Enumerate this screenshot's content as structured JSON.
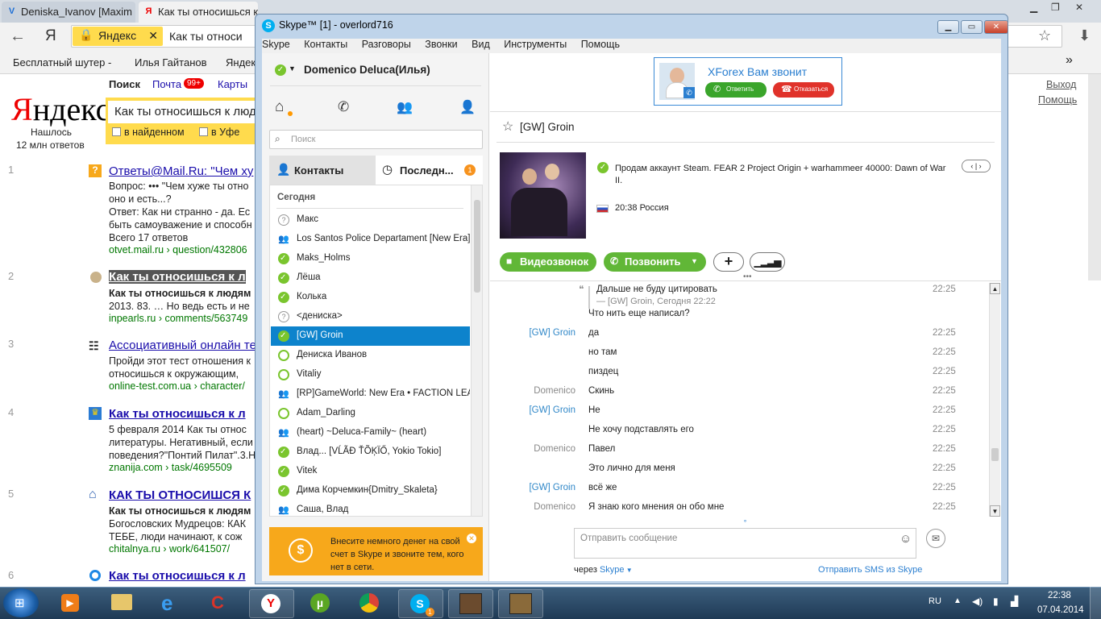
{
  "browser": {
    "tabs": [
      {
        "label": "Deniska_Ivanov [Maxim",
        "fav": "V"
      },
      {
        "label": "Как ты относишься к",
        "fav": "Я"
      }
    ],
    "back_icon": "arrow-left-icon",
    "ya_logo": "Я",
    "address_tag": "Яндекс",
    "address_text": "Как ты относи",
    "bookmarks": [
      "Бесплатный шутер -",
      "Илья Гайтанов",
      "Яндек"
    ],
    "more": "»"
  },
  "yandex": {
    "nav": [
      "Поиск",
      "Почта",
      "Карты"
    ],
    "mail_badge": "99+",
    "logo": "Яндекс",
    "found": "Нашлось",
    "found_count": "12 млн ответов",
    "query": "Как ты относишься к люд",
    "filter_in_found": "в найденном",
    "filter_city": "в Уфе",
    "exit": "Выход",
    "help": "Помощь",
    "results": [
      {
        "num": "1",
        "title": "Ответы@Mail.Ru: \"Чем ху",
        "lines": [
          "Вопрос: ••• \"Чем хуже ты отно",
          "оно и есть...?",
          "Ответ: Как ни странно - да. Ес",
          "быть самоуважение и способн",
          "Всего 17 ответов"
        ],
        "url": "otvet.mail.ru › question/432806"
      },
      {
        "num": "2",
        "title": "Как ты относишься к л",
        "lines": [
          "Как ты относишься к людям",
          "2013. 83. … Но ведь есть и не"
        ],
        "url": "inpearls.ru › comments/563749"
      },
      {
        "num": "3",
        "title": "Ассоциативный онлайн те",
        "lines": [
          "Пройди этот тест отношения к",
          "относишься к окружающим,"
        ],
        "url": "online-test.com.ua › character/"
      },
      {
        "num": "4",
        "title": "Как ты относишься к л",
        "lines": [
          "5 февраля 2014 Как ты относ",
          "литературы. Негативный, если",
          "поведения?\"Понтий Пилат\".3.Н"
        ],
        "url": "znanija.com › task/4695509"
      },
      {
        "num": "5",
        "title": "КАК ТЫ ОТНОСИШСЯ К",
        "lines": [
          "Как ты относишься к людям",
          "Богословских Мудрецов: КАК",
          "ТЕБЕ, люди начинают, к сож"
        ],
        "url": "chitalnya.ru › work/641507/"
      },
      {
        "num": "6",
        "title": "Как ты относишься к л",
        "lines": [],
        "url": ""
      }
    ]
  },
  "skype": {
    "title": "Skype™ [1] - overlord716",
    "menu": [
      "Skype",
      "Контакты",
      "Разговоры",
      "Звонки",
      "Вид",
      "Инструменты",
      "Помощь"
    ],
    "user_name": "Domenico Deluca(Илья)",
    "search_placeholder": "Поиск",
    "tab_contacts": "Контакты",
    "tab_recent": "Последн...",
    "recent_badge": "1",
    "section_today": "Сегодня",
    "contacts": [
      {
        "name": "Макс",
        "status": "unk"
      },
      {
        "name": "Los Santos Police Departament [New Era]",
        "status": "grp"
      },
      {
        "name": "Maks_Holms",
        "status": "on"
      },
      {
        "name": "Лёша",
        "status": "on"
      },
      {
        "name": "Колька",
        "status": "on"
      },
      {
        "name": "<дениска>",
        "status": "unk"
      },
      {
        "name": "[GW] Groin",
        "status": "on",
        "selected": true
      },
      {
        "name": "Дениска Иванов",
        "status": "off"
      },
      {
        "name": "Vitaliy",
        "status": "off"
      },
      {
        "name": "[RP]GameWorld: New Era • FACTION LEA...",
        "status": "grp"
      },
      {
        "name": "Adam_Darling",
        "status": "off"
      },
      {
        "name": "(heart) ~Deluca-Family~ (heart)",
        "status": "grp"
      },
      {
        "name": "Влад... [VĹÃĐ ŤÕĶÏŐ, Yokio Tokio]",
        "status": "on"
      },
      {
        "name": "Vitek",
        "status": "on"
      },
      {
        "name": "Дима Корчемкин{Dmitry_Skaleta}",
        "status": "on"
      },
      {
        "name": "Саша, Влад",
        "status": "grp"
      }
    ],
    "promo_text": "Внесите немного денег на свой счет в Skype и звоните тем, кого нет в сети.",
    "call": {
      "caller": "XForex Вам звонит",
      "answer": "Ответить",
      "decline": "Отказаться"
    },
    "chat_name": "[GW] Groin",
    "mood": "Продам аккаунт Steam. FEAR 2 Project Origin + warhammeer 40000: Dawn of War II.",
    "local_time": "20:38 Россия",
    "video_call": "Видеозвонок",
    "call_btn": "Позвонить",
    "plus": "+",
    "quote_text": "Дальше не буду цитировать",
    "quote_meta": "— [GW] Groin, Сегодня 22:22",
    "quote_time": "22:25",
    "messages": [
      {
        "who": "",
        "text": "Что нить еще написал?",
        "time": ""
      },
      {
        "who": "[GW] Groin",
        "text": "да",
        "time": "22:25"
      },
      {
        "who": "",
        "text": "но там",
        "time": "22:25"
      },
      {
        "who": "",
        "text": "пиздец",
        "time": "22:25"
      },
      {
        "who": "Domenico",
        "text": "Скинь",
        "time": "22:25"
      },
      {
        "who": "[GW] Groin",
        "text": "Не",
        "time": "22:25"
      },
      {
        "who": "",
        "text": "Не хочу подставлять его",
        "time": "22:25"
      },
      {
        "who": "Domenico",
        "text": "Павел",
        "time": "22:25"
      },
      {
        "who": "",
        "text": "Это лично для меня",
        "time": "22:25"
      },
      {
        "who": "[GW] Groin",
        "text": "всё же",
        "time": "22:25"
      },
      {
        "who": "Domenico",
        "text": "Я знаю кого мнения он обо мне",
        "time": "22:25"
      }
    ],
    "input_placeholder": "Отправить сообщение",
    "via": "через",
    "via_link": "Skype",
    "sms_link": "Отправить SMS из Skype"
  },
  "taskbar": {
    "lang": "RU",
    "time": "22:38",
    "date": "07.04.2014",
    "skype_badge": "1"
  }
}
